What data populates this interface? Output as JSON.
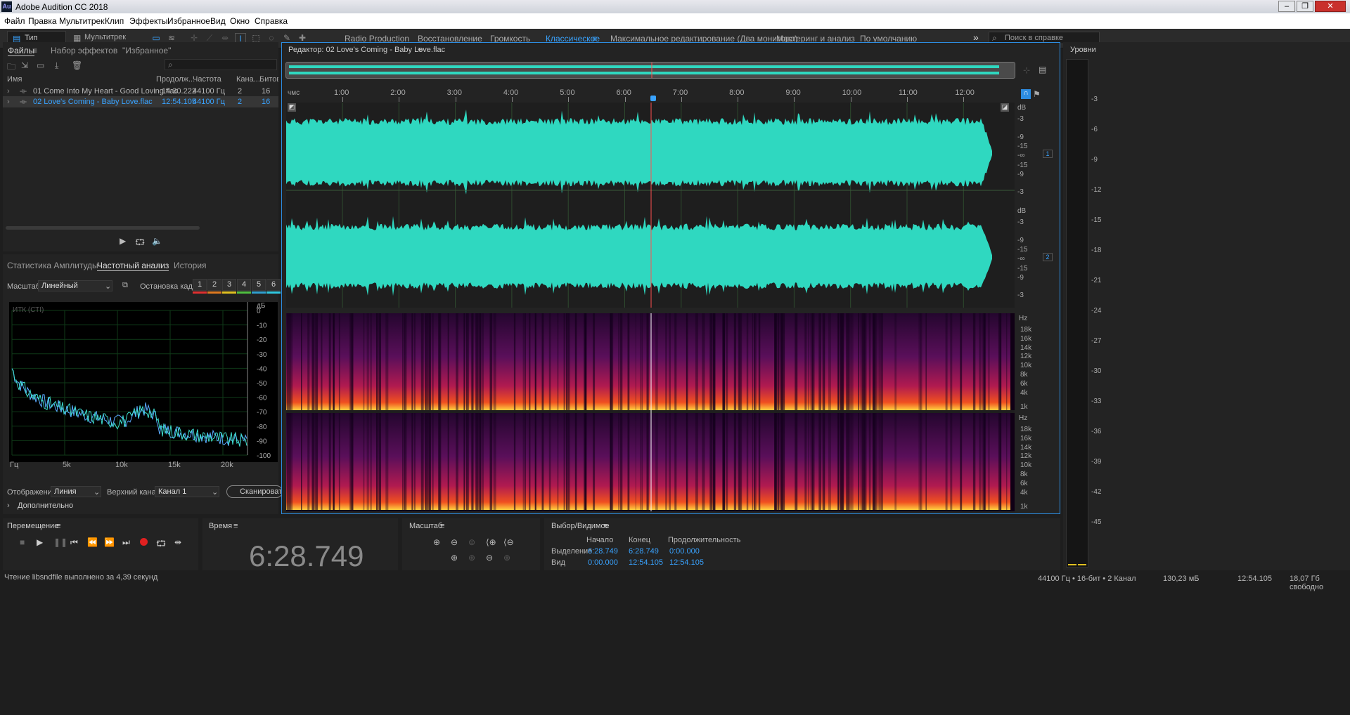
{
  "window": {
    "title": "Adobe Audition CC 2018",
    "logo": "Au"
  },
  "menu": [
    "Файл",
    "Правка",
    "Мультитрек",
    "Клип",
    "Эффекты",
    "Избранное",
    "Вид",
    "Окно",
    "Справка"
  ],
  "toolbar": {
    "waveform_label": "Тип сигнала",
    "multitrack_label": "Мультитрек",
    "workspaces": [
      "Radio Production",
      "Восстановление",
      "Громкость",
      "Классическое",
      "Максимальное редактирование (Два монитора)",
      "Мастеринг и анализ",
      "По умолчанию"
    ],
    "active_workspace": "Классическое",
    "search_placeholder": "Поиск в справке"
  },
  "files_panel": {
    "tabs": [
      "Файлы",
      "Набор эффектов",
      "\"Избранное\""
    ],
    "columns": [
      "Имя",
      "Продолж...",
      "Частота",
      "Кана...",
      "Битовая"
    ],
    "files": [
      {
        "name": "01 Come Into My Heart - Good Loving.flac",
        "duration": "14:30.222",
        "rate": "44100 Гц",
        "channels": "2",
        "bits": "16",
        "selected": false
      },
      {
        "name": "02 Love's Coming - Baby Love.flac",
        "duration": "12:54.105",
        "rate": "44100 Гц",
        "channels": "2",
        "bits": "16",
        "selected": true
      }
    ]
  },
  "analysis_panel": {
    "tabs": [
      "Статистика Амплитуды",
      "Частотный анализ",
      "История"
    ],
    "scale_label": "Масштаб:",
    "scale_value": "Линейный",
    "freeze_label": "Остановка кадра:",
    "freeze_buttons": [
      "1",
      "2",
      "3",
      "4",
      "5",
      "6"
    ],
    "freeze_colors": [
      "#e03030",
      "#e07a20",
      "#e0c020",
      "#50c040",
      "#30a0d0",
      "#30c8e0"
    ],
    "plot_label": "ИТК (СТІ)",
    "db_unit": "дБ",
    "db_ticks": [
      "0",
      "-10",
      "-20",
      "-30",
      "-40",
      "-50",
      "-60",
      "-70",
      "-80",
      "-90",
      "-100"
    ],
    "freq_ticks": [
      "Гц",
      "5k",
      "10k",
      "15k",
      "20k"
    ],
    "display_label": "Отображение:",
    "display_value": "Линия",
    "channel_label": "Верхний канал:",
    "channel_value": "Канал 1",
    "scan_button": "Сканировать",
    "more_label": "Дополнительно"
  },
  "editor": {
    "title": "Редактор: 02 Love's Coming - Baby Love.flac",
    "time_unit": "чмс",
    "timeline": [
      "1:00",
      "2:00",
      "3:00",
      "4:00",
      "5:00",
      "6:00",
      "7:00",
      "8:00",
      "9:00",
      "10:00",
      "11:00",
      "12:00"
    ],
    "db_unit": "dB",
    "db_ticks_ch": [
      "-3",
      "-9",
      "-15",
      "-∞",
      "-15",
      "-9",
      "-3"
    ],
    "channels": [
      "1",
      "2"
    ],
    "hz_unit": "Hz",
    "hz_ticks": [
      "18k",
      "16k",
      "14k",
      "12k",
      "10k",
      "8k",
      "6k",
      "4k",
      "1k"
    ],
    "waveform_color": "#2fd8c0",
    "playhead_color": "#ff5050"
  },
  "levels": {
    "title": "Уровни",
    "ticks": [
      "-3",
      "-6",
      "-9",
      "-12",
      "-15",
      "-18",
      "-21",
      "-24",
      "-27",
      "-30",
      "-33",
      "-36",
      "-39",
      "-42",
      "-45"
    ]
  },
  "transport": {
    "title": "Перемещение"
  },
  "time": {
    "title": "Время",
    "value": "6:28.749"
  },
  "zoom": {
    "title": "Масштаб"
  },
  "selection": {
    "title": "Выбор/Видимое",
    "col_start": "Начало",
    "col_end": "Конец",
    "col_dur": "Продолжительность",
    "sel_label": "Выделение",
    "sel_start": "6:28.749",
    "sel_end": "6:28.749",
    "sel_dur": "0:00.000",
    "view_label": "Вид",
    "view_start": "0:00.000",
    "view_end": "12:54.105",
    "view_dur": "12:54.105"
  },
  "status": {
    "left": "Чтение libsndfile выполнено за 4,39 секунд",
    "format": "44100 Гц • 16-бит • 2 Канал",
    "size": "130,23 мБ",
    "duration": "12:54.105",
    "free": "18,07 Гб свободно"
  }
}
